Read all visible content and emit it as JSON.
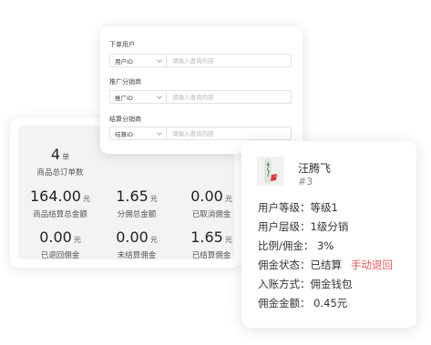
{
  "stats": {
    "order_count": {
      "value": "4",
      "unit": "单",
      "label": "商品总订单数"
    },
    "settle_total": {
      "value": "164.00",
      "unit": "元",
      "label": "商品结算总金额"
    },
    "commission_total": {
      "value": "1.65",
      "unit": "元",
      "label": "分佣总金额"
    },
    "cancelled_commission": {
      "value": "0.00",
      "unit": "元",
      "label": "已取消佣金"
    },
    "returned_commission": {
      "value": "0.00",
      "unit": "元",
      "label": "已退回佣金"
    },
    "unsettled_commission": {
      "value": "0.00",
      "unit": "元",
      "label": "未结算佣金"
    },
    "settled_commission": {
      "value": "1.65",
      "unit": "元",
      "label": "已结算佣金"
    }
  },
  "filters": {
    "order_user": {
      "label": "下单用户",
      "select": "用户ID",
      "placeholder": "请输入查询内容"
    },
    "promoter": {
      "label": "推广分销商",
      "select": "推广ID",
      "placeholder": "请输入查询内容"
    },
    "settler": {
      "label": "结算分销商",
      "select": "结算ID",
      "placeholder": "请输入查询内容"
    }
  },
  "user": {
    "name": "汪腾飞",
    "id": "#3",
    "level": "用户等级：等级1",
    "tier": "用户层级：1级分销",
    "ratio": "比例/佣金：  3%",
    "status": "佣金状态：已结算",
    "refund_action": "手动退回",
    "account": "入账方式：佣金钱包",
    "amount": "佣金金额：  0.45元"
  },
  "colors": {
    "danger": "#ee5555",
    "panel_bg": "#f3f3f3"
  }
}
